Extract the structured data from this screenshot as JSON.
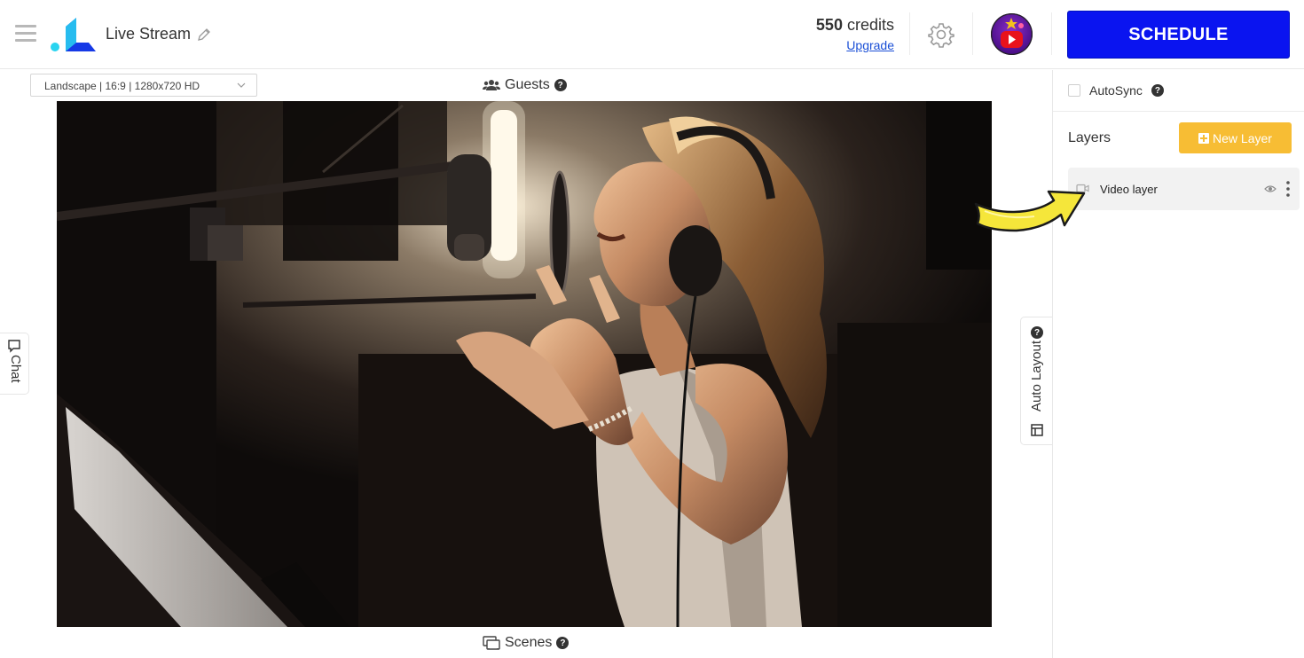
{
  "header": {
    "title": "Live Stream",
    "credits_amount": "550",
    "credits_label": "credits",
    "upgrade_label": "Upgrade",
    "schedule_label": "SCHEDULE"
  },
  "stage": {
    "resolution_value": "Landscape | 16:9 | 1280x720 HD",
    "guests_label": "Guests",
    "scenes_label": "Scenes",
    "chat_label": "Chat",
    "auto_layout_label": "Auto Layout"
  },
  "sidebar": {
    "autosync_label": "AutoSync",
    "autosync_checked": false,
    "layers_title": "Layers",
    "new_layer_label": "New Layer",
    "layers": [
      {
        "name": "Video layer",
        "visible": true
      }
    ]
  },
  "colors": {
    "schedule_bg": "#0a14f0",
    "new_layer_bg": "#f7bd34",
    "link": "#1a4fd6",
    "annotation_arrow": "#f5e63a"
  }
}
